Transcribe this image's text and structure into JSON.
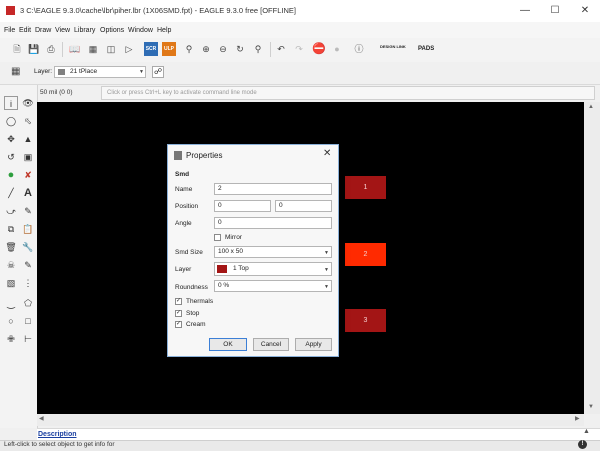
{
  "window": {
    "title": "3 C:\\EAGLE 9.3.0\\cache\\lbr\\piher.lbr (1X06SMD.fpt) - EAGLE 9.3.0 free [OFFLINE]",
    "min_icon": "minimize-icon",
    "max_icon": "maximize-icon",
    "close_icon": "close-icon"
  },
  "menu": [
    "File",
    "Edit",
    "Draw",
    "View",
    "Library",
    "Options",
    "Window",
    "Help"
  ],
  "toolbar": {
    "scr_label": "SCR",
    "ulp_label": "ULP",
    "design_link_label": "DESIGN LINK",
    "pads_label": "PADS"
  },
  "parameter_bar": {
    "layer_label": "Layer:",
    "layer_value": "21 tPlace",
    "layer_color": "#808080"
  },
  "command": {
    "coords": "50 mil (0 0)",
    "placeholder": "Click or press Ctrl+L key to activate command line mode"
  },
  "canvas": {
    "background": "#000000",
    "pads": [
      {
        "label": "1",
        "color": "#a31515"
      },
      {
        "label": "2",
        "color": "#ff2a00"
      },
      {
        "label": "3",
        "color": "#a31515"
      }
    ]
  },
  "dialog": {
    "title": "Properties",
    "section": "Smd",
    "name_label": "Name",
    "name_value": "2",
    "position_label": "Position",
    "position_x": "0",
    "position_y": "0",
    "angle_label": "Angle",
    "angle_value": "0",
    "mirror_label": "Mirror",
    "mirror_checked": false,
    "smd_size_label": "Smd Size",
    "smd_size_value": "100 x 50",
    "layer_label": "Layer",
    "layer_value": "1 Top",
    "layer_color": "#a31515",
    "roundness_label": "Roundness",
    "roundness_value": "0 %",
    "thermals_label": "Thermals",
    "stop_label": "Stop",
    "cream_label": "Cream",
    "thermals_checked": true,
    "stop_checked": true,
    "cream_checked": true,
    "ok_label": "OK",
    "cancel_label": "Cancel",
    "apply_label": "Apply"
  },
  "bottom": {
    "description_link": "Description",
    "status": "Left-click to select object to get info for"
  }
}
